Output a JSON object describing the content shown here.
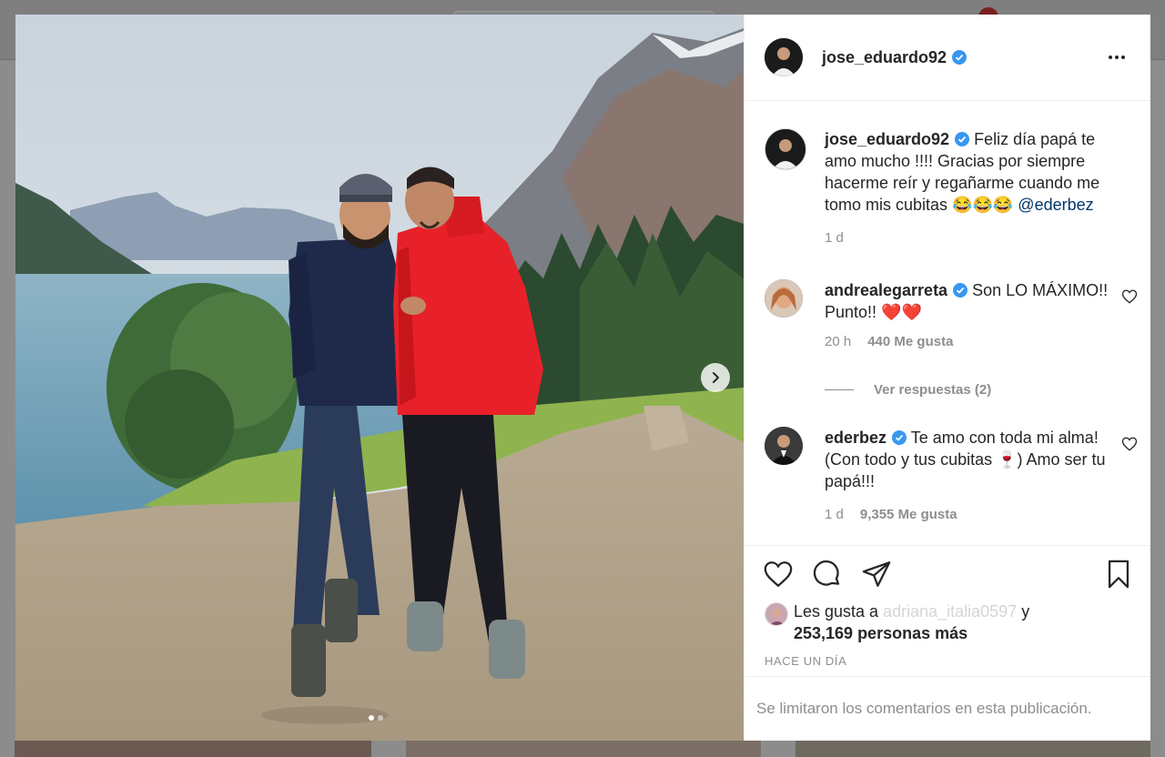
{
  "post": {
    "author": "jose_eduardo92",
    "verified": true,
    "image_alt": "",
    "carousel": {
      "current": 1,
      "total": 2
    }
  },
  "caption": {
    "username": "jose_eduardo92",
    "text": "Feliz día papá te amo mucho !!!! Gracias por siempre hacerme reír y regañarme cuando me tomo mis cubitas 😂😂😂 ",
    "mention": "@ederbez",
    "time": "1 d"
  },
  "comments": [
    {
      "username": "andrealegarreta",
      "text": "Son LO MÁXIMO!! Punto!! ❤️❤️",
      "time": "20 h",
      "likes": "440 Me gusta"
    },
    {
      "username": "ederbez",
      "text": "Te amo con toda mi alma! (Con todo y tus cubitas 🍷) Amo ser tu papá!!!",
      "time": "1 d",
      "likes": "9,355 Me gusta"
    }
  ],
  "view_replies": "Ver respuestas (2)",
  "likes_summary": {
    "prefix": "Les gusta a ",
    "blurred_user": "adriana_italia0597",
    "suffix": " y",
    "count_text": "253,169 personas más"
  },
  "time_ago": "HACE UN DÍA",
  "comments_limited": "Se limitaron los comentarios en esta publicación.",
  "colors": {
    "verified": "#3897f0",
    "mention": "#00376b",
    "muted": "#8e8e8e",
    "jacket": "#e8202a"
  },
  "icons": [
    "heart-icon",
    "comment-icon",
    "share-icon",
    "bookmark-icon",
    "more-options-icon",
    "chevron-right-icon",
    "verified-badge-icon"
  ]
}
